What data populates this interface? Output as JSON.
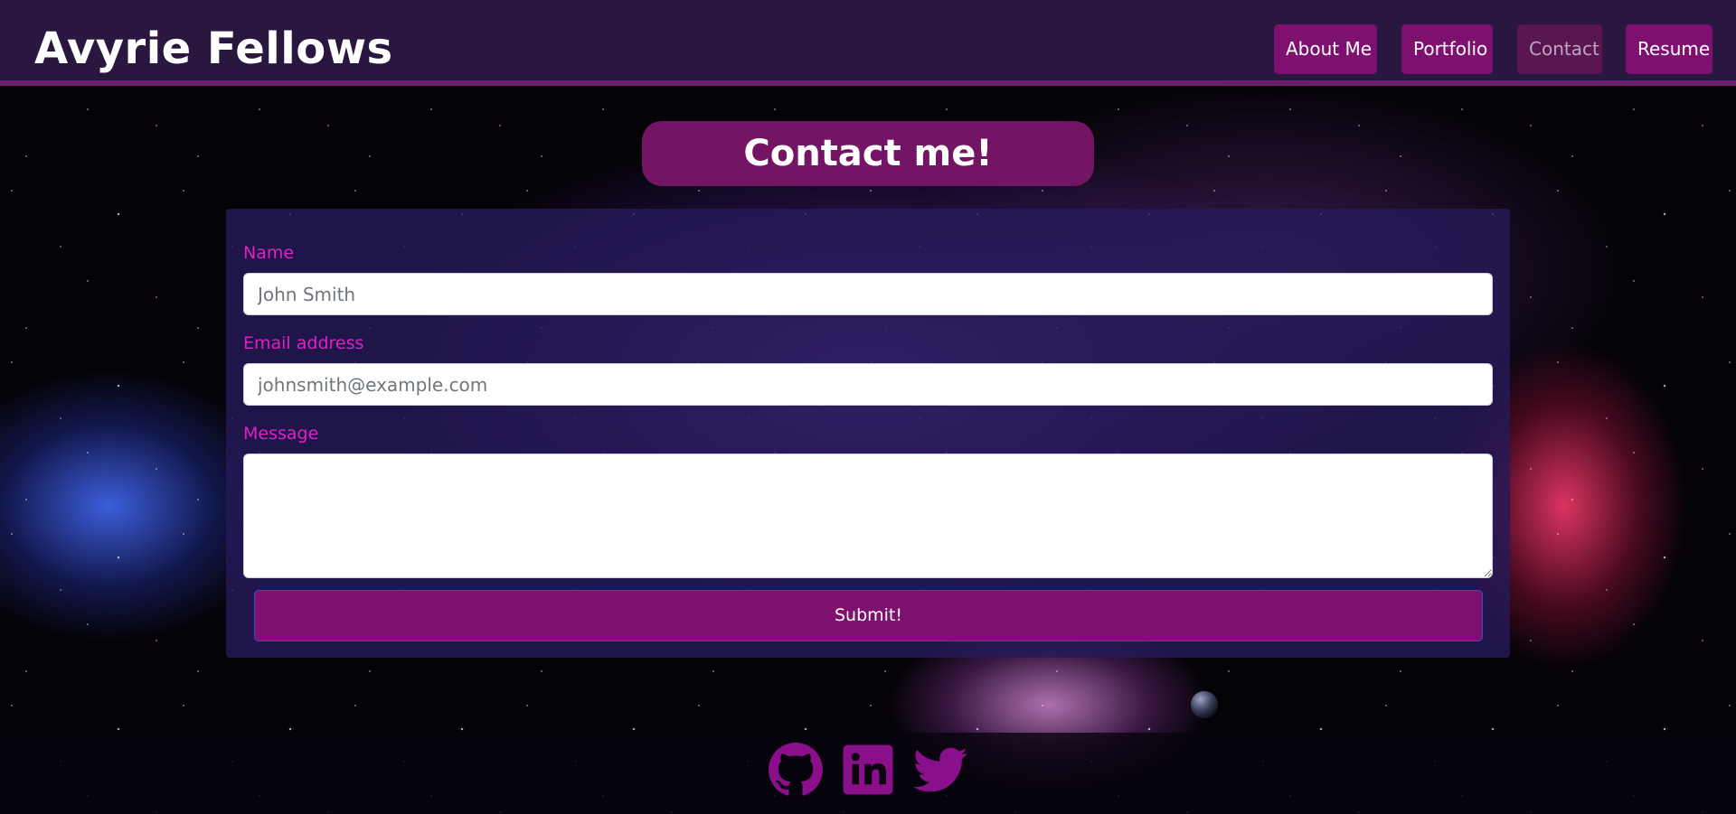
{
  "navbar": {
    "brand": "Avyrie Fellows",
    "links": [
      {
        "label": "About Me",
        "active": false
      },
      {
        "label": "Portfolio",
        "active": false
      },
      {
        "label": "Contact",
        "active": true
      },
      {
        "label": "Resume",
        "active": false
      }
    ]
  },
  "main": {
    "heading": "Contact me!",
    "form": {
      "name": {
        "label": "Name",
        "value": "",
        "placeholder": "John Smith"
      },
      "email": {
        "label": "Email address",
        "value": "",
        "placeholder": "johnsmith@example.com"
      },
      "message": {
        "label": "Message",
        "value": "",
        "placeholder": ""
      },
      "submit_label": "Submit!"
    }
  },
  "footer": {
    "icons": [
      "github-icon",
      "linkedin-icon",
      "twitter-icon"
    ]
  },
  "colors": {
    "navbar_bg": "#2a1740",
    "accent": "#7e1170",
    "label": "#e020c8",
    "icon": "#8a0f8a"
  }
}
